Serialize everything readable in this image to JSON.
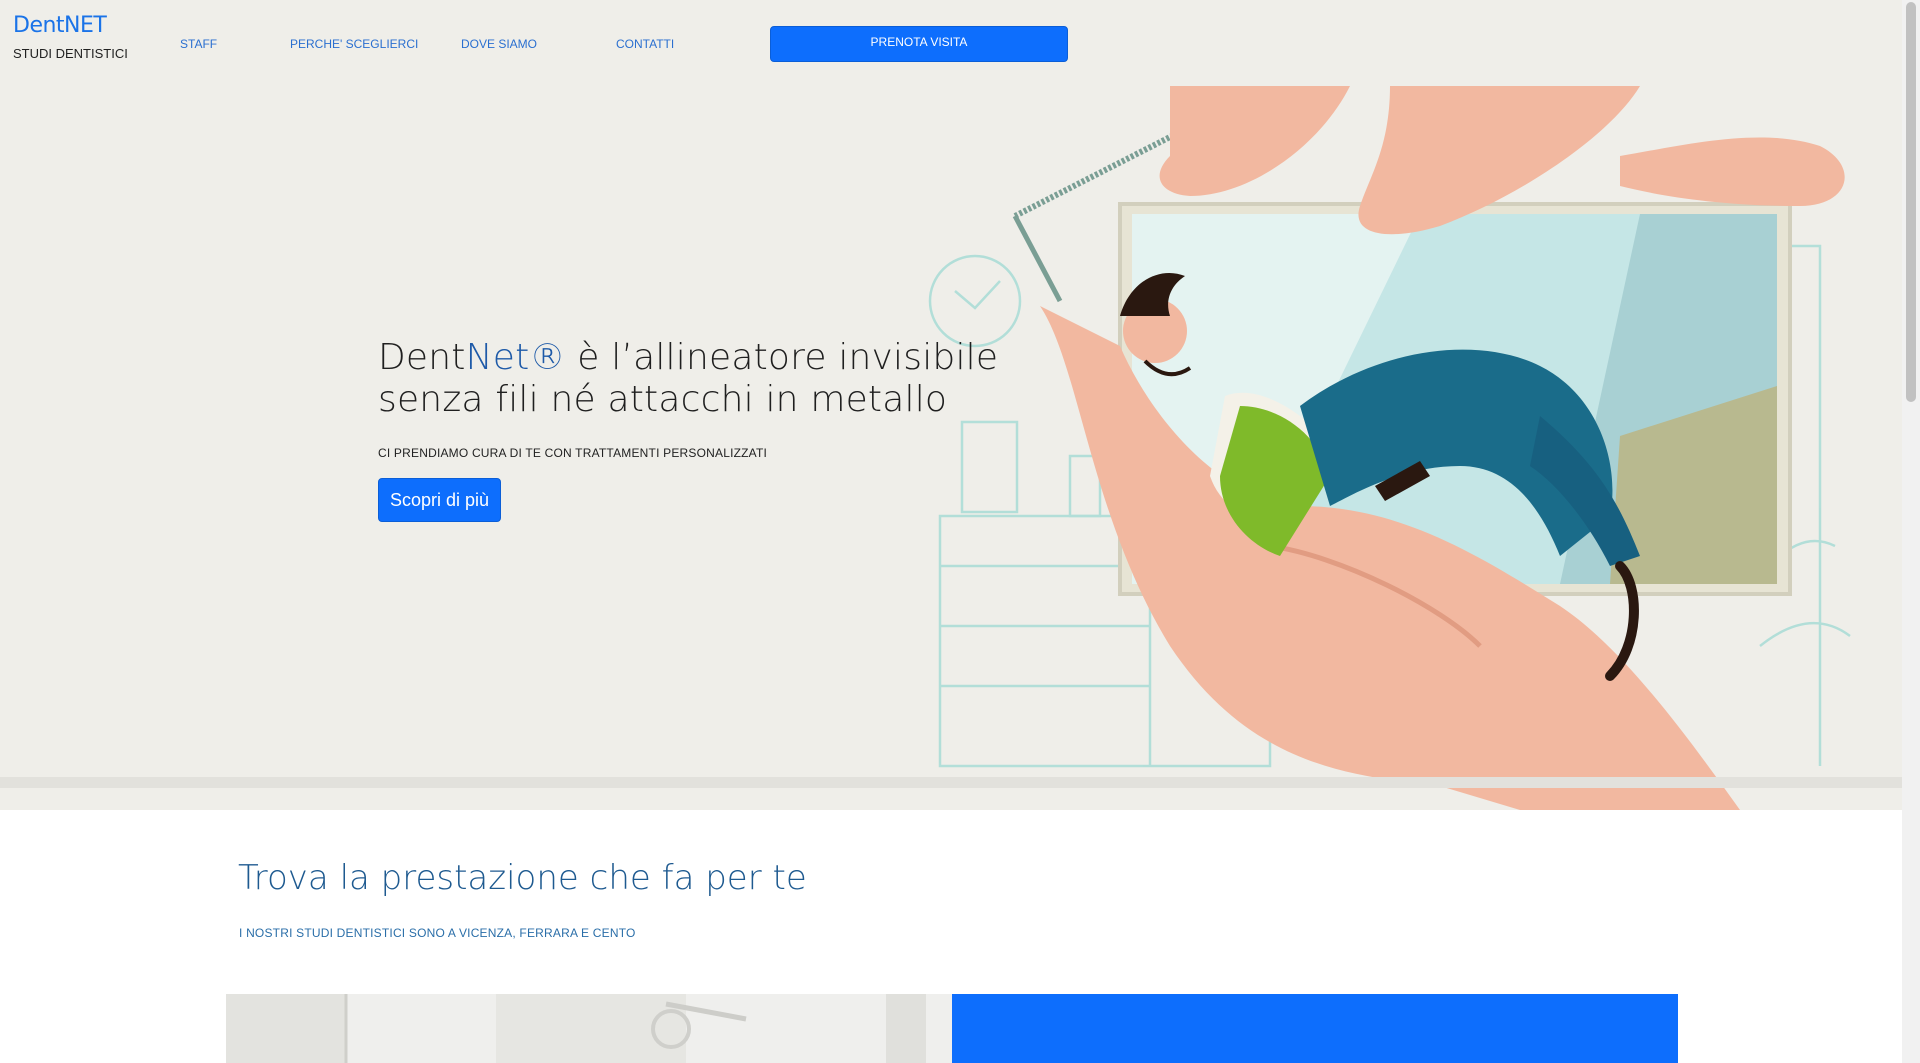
{
  "header": {
    "brand": "DentNET",
    "brand_sub": "STUDI DENTISTICI",
    "nav": [
      "STAFF",
      "PERCHE' SCEGLIERCI",
      "DOVE SIAMO",
      "CONTATTI"
    ],
    "cta": "PRENOTA VISITA"
  },
  "hero": {
    "title_part1": "Dent",
    "title_accent": "Net®",
    "title_part2": " è l’allineatore invisibile",
    "title_line2": "senza fili né attacchi in metallo",
    "subtitle": "CI PRENDIAMO CURA DI TE CON TRATTAMENTI PERSONALIZZATI",
    "button": "Scopri di più"
  },
  "section": {
    "title": "Trova la prestazione che fa per te",
    "subtitle": "I NOSTRI STUDI DENTISTICI SONO A VICENZA, FERRARA E CENTO"
  },
  "colors": {
    "accent": "#0d6efd",
    "hero_bg": "#efeee9",
    "title_blue": "#1e5a90"
  }
}
